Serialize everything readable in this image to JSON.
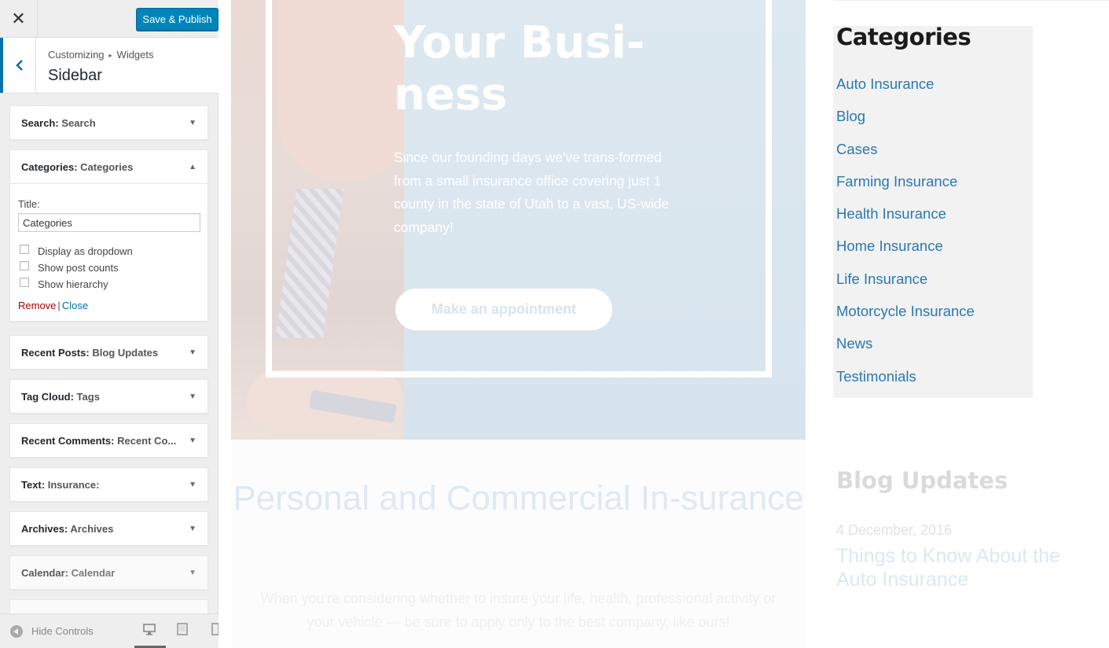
{
  "customizer": {
    "close_icon": "close-icon",
    "save_label": "Save & Publish",
    "breadcrumb": [
      "Customizing",
      "Widgets"
    ],
    "breadcrumb_sep": "▸",
    "section_title": "Sidebar",
    "hide_controls": "Hide Controls",
    "accent": "#0073aa",
    "widgets": [
      {
        "type": "Search",
        "title": "Search"
      },
      {
        "type": "Categories",
        "title": "Categories"
      },
      {
        "type": "Recent Posts",
        "title": "Blog Updates"
      },
      {
        "type": "Tag Cloud",
        "title": "Tags"
      },
      {
        "type": "Recent Comments",
        "title": "Recent Co..."
      },
      {
        "type": "Text",
        "title": "Insurance:"
      },
      {
        "type": "Archives",
        "title": "Archives"
      },
      {
        "type": "Calendar",
        "title": "Calendar"
      }
    ],
    "expanded_form": {
      "title_label": "Title:",
      "title_value": "Categories",
      "options": [
        "Display as dropdown",
        "Show post counts",
        "Show hierarchy"
      ],
      "remove": "Remove",
      "sep": "|",
      "close": "Close"
    }
  },
  "preview": {
    "hero_title": "Your Busi-ness",
    "hero_text": "Since our founding days we've trans-formed from a small insurance office covering just 1 county in the state of Utah to a vast, US-wide company!",
    "hero_button": "Make an appointment",
    "section_title": "Personal and Commercial In-surance",
    "section_text": "When you're considering whether to insure your life, health, professional activity or your vehicle — be sure to apply only to the best company, like ours!",
    "categories_title": "Categories",
    "categories": [
      "Auto Insurance",
      "Blog",
      "Cases",
      "Farming Insurance",
      "Health Insurance",
      "Home Insurance",
      "Life Insurance",
      "Motorcycle Insurance",
      "News",
      "Testimonials"
    ],
    "blog_title": "Blog Updates",
    "blog_date": "4 December, 2016",
    "blog_post": "Things to Know About the Auto Insurance",
    "link_color": "#2a78b0"
  }
}
